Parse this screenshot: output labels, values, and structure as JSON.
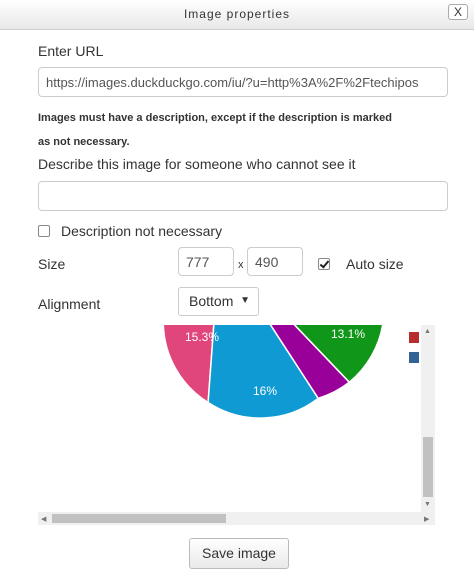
{
  "dialog": {
    "title": "Image properties",
    "close_label": "X"
  },
  "url": {
    "label": "Enter URL",
    "value": "https://images.duckduckgo.com/iu/?u=http%3A%2F%2Ftechipos"
  },
  "description": {
    "notice_line1": "Images must have a description, except if the description is marked",
    "notice_line2": "as not necessary.",
    "label": "Describe this image for someone who cannot see it",
    "value": "",
    "not_necessary_label": "Description not necessary",
    "not_necessary_checked": false
  },
  "size": {
    "label": "Size",
    "width": "777",
    "separator": "x",
    "height": "490",
    "auto_size_label": "Auto size",
    "auto_size_checked": true
  },
  "alignment": {
    "label": "Alignment",
    "selected": "Bottom"
  },
  "preview": {
    "slices": [
      {
        "label": "15.3%",
        "color": "#e0457b"
      },
      {
        "label": "16%",
        "color": "#109ad3"
      },
      {
        "label": "",
        "color": "#990099"
      },
      {
        "label": "13.1%",
        "color": "#109618"
      }
    ],
    "legend_colors": [
      "#b82e2e",
      "#316395"
    ]
  },
  "save_label": "Save image"
}
